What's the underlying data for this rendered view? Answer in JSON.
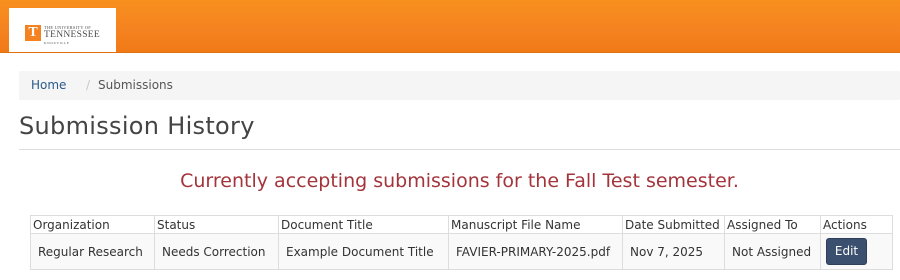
{
  "header": {
    "logo": {
      "line1": "THE UNIVERSITY OF",
      "line2": "TENNESSEE",
      "line3": "KNOXVILLE",
      "mark": "T"
    },
    "accent_color": "#f58220"
  },
  "breadcrumb": {
    "home": "Home",
    "separator": "/",
    "current": "Submissions"
  },
  "page": {
    "title": "Submission History",
    "notice": "Currently accepting submissions for the Fall Test semester.",
    "notice_color": "#a3343b"
  },
  "table": {
    "columns": [
      "Organization",
      "Status",
      "Document Title",
      "Manuscript File Name",
      "Date Submitted",
      "Assigned To",
      "Actions"
    ],
    "rows": [
      {
        "organization": "Regular Research",
        "status": "Needs Correction",
        "document_title": "Example Document Title",
        "file_name": "FAVIER-PRIMARY-2025.pdf",
        "date_submitted": "Nov 7, 2025",
        "assigned_to": "Not Assigned",
        "action_label": "Edit"
      }
    ]
  }
}
